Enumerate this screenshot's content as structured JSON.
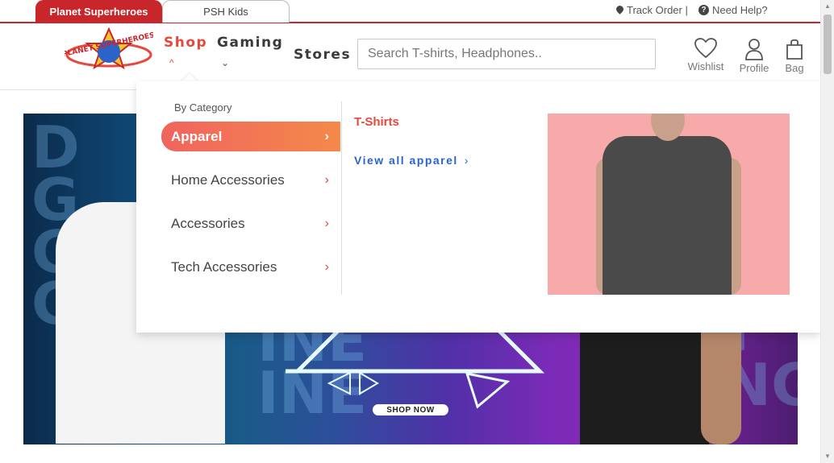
{
  "topbar": {
    "site_tabs": [
      {
        "label": "Planet Superheroes",
        "active": true
      },
      {
        "label": "PSH Kids",
        "active": false
      }
    ],
    "track_order": "Track Order |",
    "need_help": "Need Help?"
  },
  "header": {
    "logo_text": "PLANET SUPERHEROES",
    "nav": {
      "shop": "Shop",
      "gaming": "Gaming",
      "stores": "Stores"
    },
    "search_placeholder": "Search T-shirts, Headphones..",
    "icons": {
      "wishlist": "Wishlist",
      "profile": "Profile",
      "bag": "Bag"
    }
  },
  "mega_menu": {
    "category_title": "By Category",
    "categories": [
      {
        "label": "Apparel",
        "active": true
      },
      {
        "label": "Home Accessories",
        "active": false
      },
      {
        "label": "Accessories",
        "active": false
      },
      {
        "label": "Tech Accessories",
        "active": false
      }
    ],
    "subcategory": "T-Shirts",
    "view_all": "View all apparel"
  },
  "banner": {
    "cta": "SHOP NOW"
  },
  "colors": {
    "brand_red": "#c8262b",
    "accent_orange": "#e8473c",
    "link_blue": "#2a64c8"
  }
}
